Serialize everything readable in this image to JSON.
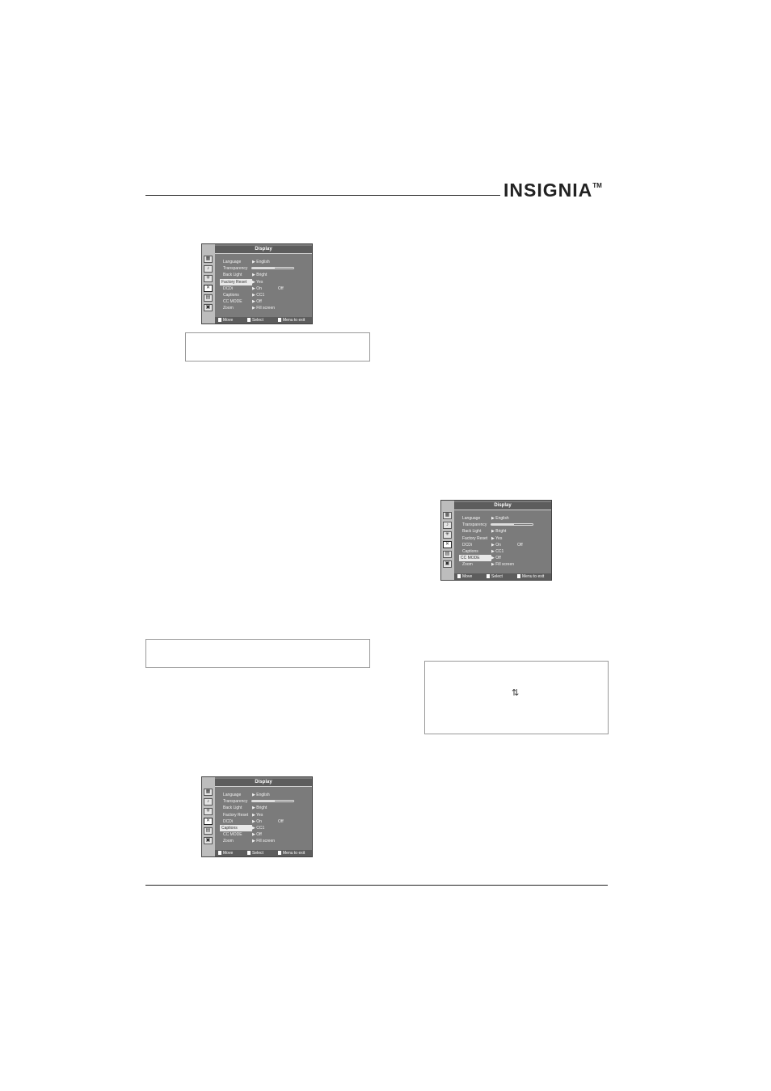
{
  "brand": {
    "logo_text": "INSIGNIA",
    "trademark": "TM"
  },
  "menus": [
    {
      "title": "Display",
      "highlighted": "Factory Reset",
      "rows": [
        {
          "label": "Language",
          "value": "English",
          "type": "text"
        },
        {
          "label": "Transparency",
          "type": "bar",
          "level": 0.55
        },
        {
          "label": "Back Light",
          "value": "Bright",
          "type": "text"
        },
        {
          "label": "Factory Reset",
          "value": "Yes",
          "type": "text"
        },
        {
          "label": "DCDi",
          "value": "On",
          "extra": "Off",
          "type": "text"
        },
        {
          "label": "Captions",
          "value": "CC1",
          "type": "text"
        },
        {
          "label": "CC MODE",
          "value": "Off",
          "type": "text"
        },
        {
          "label": "Zoom",
          "value": "Fill screen",
          "type": "text"
        }
      ],
      "footer": {
        "move": "Move",
        "select": "Select",
        "exit": "Menu to exit"
      }
    },
    {
      "title": "Display",
      "highlighted": "CC MODE",
      "rows": [
        {
          "label": "Language",
          "value": "English",
          "type": "text"
        },
        {
          "label": "Transparency",
          "type": "bar",
          "level": 0.55
        },
        {
          "label": "Back Light",
          "value": "Bright",
          "type": "text"
        },
        {
          "label": "Factory Reset",
          "value": "Yes",
          "type": "text"
        },
        {
          "label": "DCDi",
          "value": "On",
          "extra": "Off",
          "type": "text"
        },
        {
          "label": "Captions",
          "value": "CC1",
          "type": "text"
        },
        {
          "label": "CC MODE",
          "value": "Off",
          "type": "text"
        },
        {
          "label": "Zoom",
          "value": "Fill screen",
          "type": "text"
        }
      ],
      "footer": {
        "move": "Move",
        "select": "Select",
        "exit": "Menu to exit"
      }
    },
    {
      "title": "Display",
      "highlighted": "Captions",
      "rows": [
        {
          "label": "Language",
          "value": "English",
          "type": "text"
        },
        {
          "label": "Transparency",
          "type": "bar",
          "level": 0.55
        },
        {
          "label": "Back Light",
          "value": "Bright",
          "type": "text"
        },
        {
          "label": "Factory Reset",
          "value": "Yes",
          "type": "text"
        },
        {
          "label": "DCDi",
          "value": "On",
          "extra": "Off",
          "type": "text"
        },
        {
          "label": "Captions",
          "value": "CC1",
          "type": "text"
        },
        {
          "label": "CC MODE",
          "value": "Off",
          "type": "text"
        },
        {
          "label": "Zoom",
          "value": "Fill screen",
          "type": "text"
        }
      ],
      "footer": {
        "move": "Move",
        "select": "Select",
        "exit": "Menu to exit"
      }
    }
  ],
  "swap_symbol": "⇅"
}
